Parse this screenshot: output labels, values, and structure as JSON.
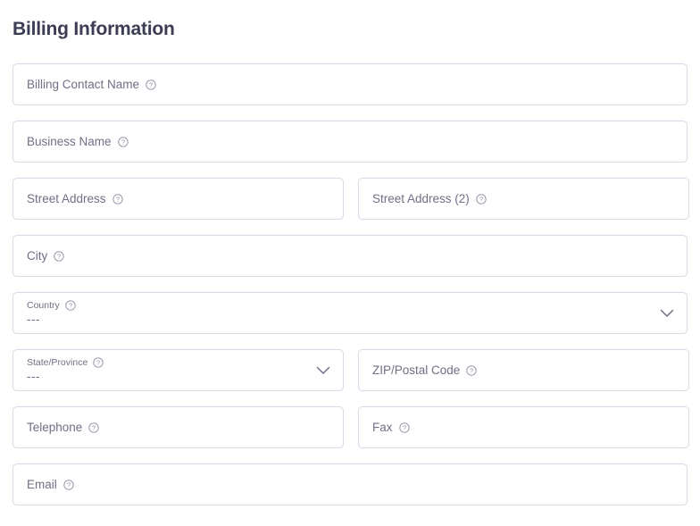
{
  "page": {
    "title": "Billing Information"
  },
  "icons": {
    "help": "help-circle-icon",
    "chevron": "chevron-down-icon"
  },
  "colors": {
    "title": "#3c3c55",
    "border": "#d9d8e6",
    "label": "#6f6f85",
    "background": "#ffffff"
  },
  "form": {
    "rows": [
      {
        "fields": [
          {
            "name": "billing-contact-name",
            "label": "Billing Contact Name",
            "type": "text",
            "value": "",
            "width": "full"
          }
        ]
      },
      {
        "fields": [
          {
            "name": "business-name",
            "label": "Business Name",
            "type": "text",
            "value": "",
            "width": "full"
          }
        ]
      },
      {
        "fields": [
          {
            "name": "street-address",
            "label": "Street Address",
            "type": "text",
            "value": "",
            "width": "half"
          },
          {
            "name": "street-address-2",
            "label": "Street Address (2)",
            "type": "text",
            "value": "",
            "width": "half"
          }
        ]
      },
      {
        "fields": [
          {
            "name": "city",
            "label": "City",
            "type": "text",
            "value": "",
            "width": "full"
          }
        ]
      },
      {
        "fields": [
          {
            "name": "country",
            "label": "Country",
            "type": "select",
            "value": "---",
            "width": "full"
          }
        ]
      },
      {
        "fields": [
          {
            "name": "state-province",
            "label": "State/Province",
            "type": "select",
            "value": "---",
            "width": "half"
          },
          {
            "name": "zip-postal-code",
            "label": "ZIP/Postal Code",
            "type": "text",
            "value": "",
            "width": "half"
          }
        ]
      },
      {
        "fields": [
          {
            "name": "telephone",
            "label": "Telephone",
            "type": "text",
            "value": "",
            "width": "half"
          },
          {
            "name": "fax",
            "label": "Fax",
            "type": "text",
            "value": "",
            "width": "half"
          }
        ]
      },
      {
        "fields": [
          {
            "name": "email",
            "label": "Email",
            "type": "text",
            "value": "",
            "width": "full"
          }
        ]
      }
    ]
  }
}
